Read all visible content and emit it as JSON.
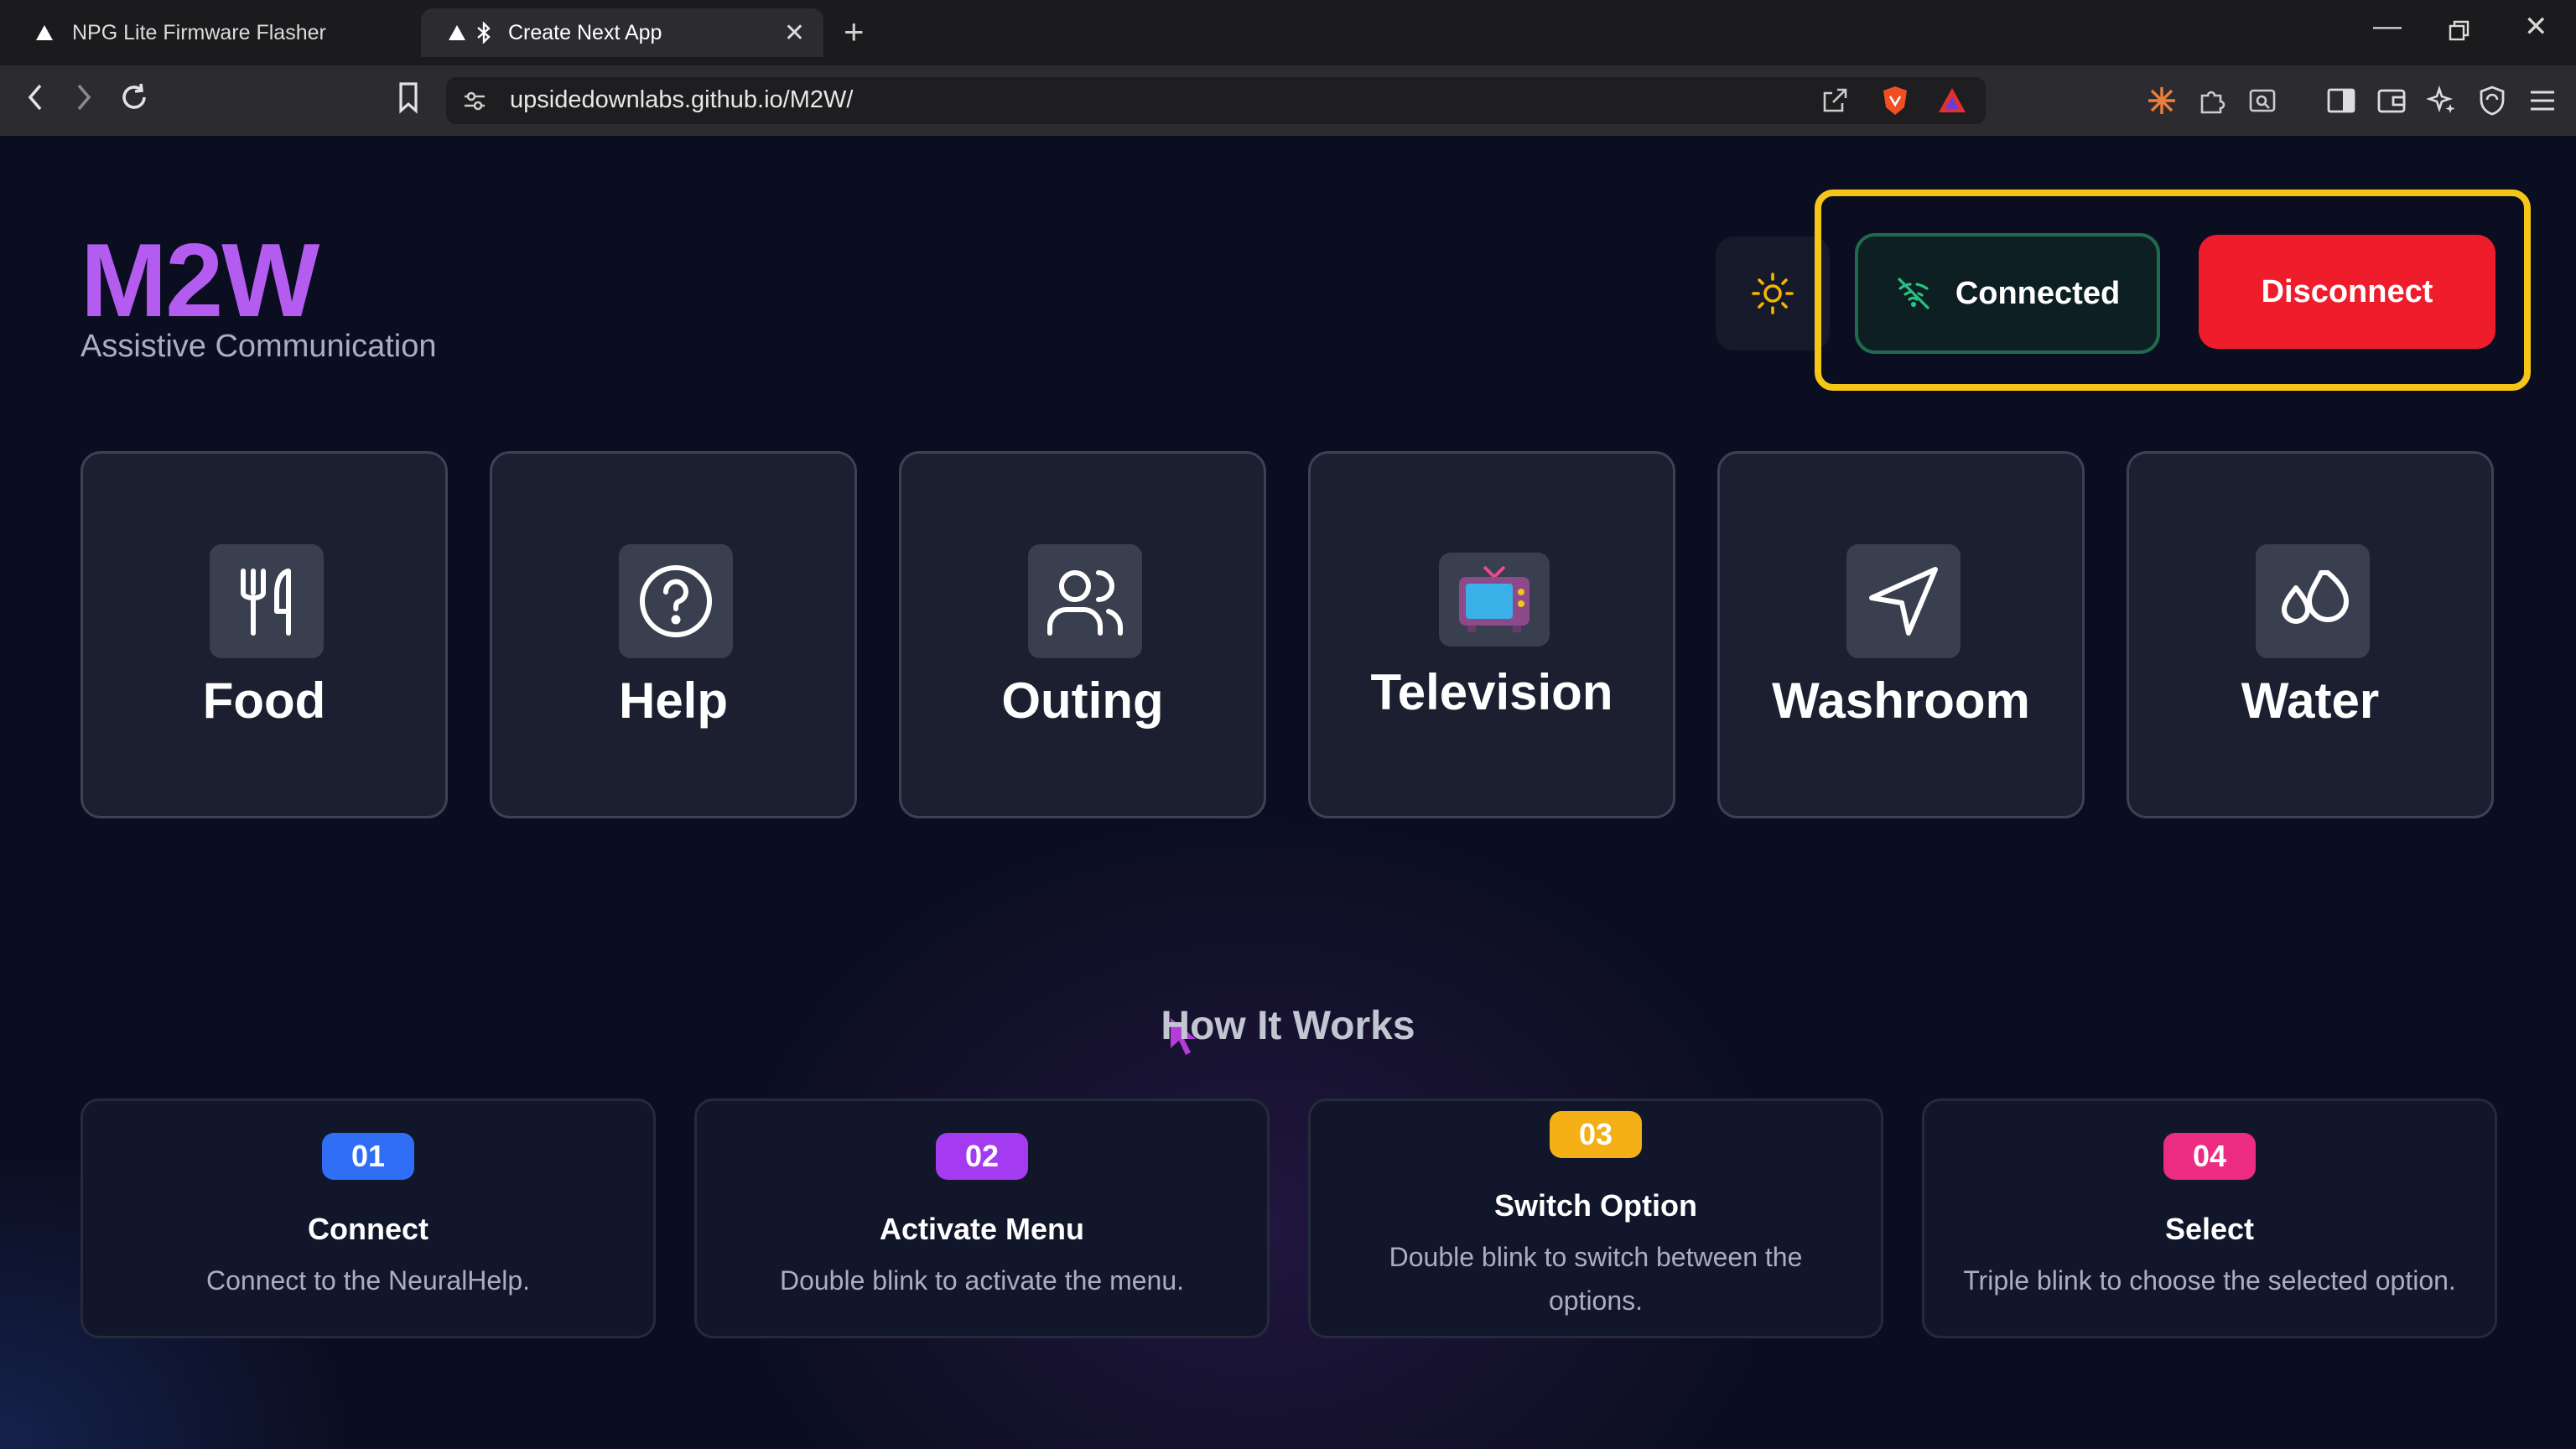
{
  "browser": {
    "tabs": [
      {
        "label": "NPG Lite Firmware Flasher",
        "active": false
      },
      {
        "label": "Create Next App",
        "active": true
      }
    ],
    "url": "upsidedownlabs.github.io/M2W/"
  },
  "app": {
    "logo": "M2W",
    "subtitle": "Assistive Communication",
    "status": "Connected",
    "disconnect_label": "Disconnect"
  },
  "tiles": [
    {
      "label": "Food",
      "icon": "fork-knife-icon"
    },
    {
      "label": "Help",
      "icon": "question-icon"
    },
    {
      "label": "Outing",
      "icon": "users-icon"
    },
    {
      "label": "Television",
      "icon": "tv-icon"
    },
    {
      "label": "Washroom",
      "icon": "navigation-arrow-icon"
    },
    {
      "label": "Water",
      "icon": "droplets-icon"
    }
  ],
  "how_it_works": {
    "title": "How It Works",
    "steps": [
      {
        "num": "01",
        "title": "Connect",
        "desc": "Connect to the NeuralHelp.",
        "color": "#2f6ef5"
      },
      {
        "num": "02",
        "title": "Activate Menu",
        "desc": "Double blink to activate the menu.",
        "color": "#a43bf0"
      },
      {
        "num": "03",
        "title": "Switch Option",
        "desc": "Double blink to switch between the options.",
        "color": "#f4b014"
      },
      {
        "num": "04",
        "title": "Select",
        "desc": "Triple blink to choose the selected option.",
        "color": "#ec2b82"
      }
    ]
  },
  "colors": {
    "accent": "#b45cf0",
    "connected_border": "#1f6b4e",
    "disconnect": "#ef1c2c",
    "highlight": "#f5c518"
  }
}
